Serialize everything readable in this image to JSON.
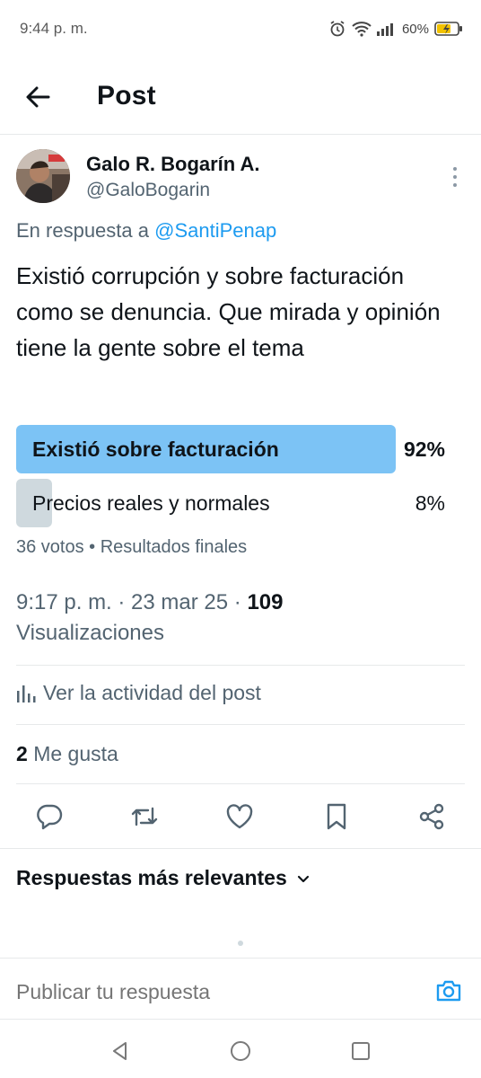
{
  "status_bar": {
    "time": "9:44 p. m.",
    "battery": "60%",
    "icons": [
      "alarm-icon",
      "wifi-icon",
      "signal-icon",
      "battery-charging-icon"
    ]
  },
  "header": {
    "title": "Post",
    "back_icon": "arrow-left-icon"
  },
  "post": {
    "author_name": "Galo R. Bogarín A.",
    "author_handle": "@GaloBogarin",
    "reply_prefix": "En respuesta a",
    "reply_mention": "@SantiPenap",
    "text": "Existió corrupción y sobre facturación como se denuncia. Que mirada y opinión tiene la gente sobre el tema",
    "poll": {
      "options": [
        {
          "label": "Existió sobre facturación",
          "percent_text": "92%",
          "percent": 92,
          "winner": true
        },
        {
          "label": "Precios reales y normales",
          "percent_text": "8%",
          "percent": 8,
          "winner": false
        }
      ],
      "meta": "36 votos • Resultados finales"
    },
    "timestamp": "9:17 p. m. · 23 mar 25 ·",
    "views_count": "109",
    "views_label": "Visualizaciones",
    "activity_label": "Ver la actividad del post",
    "likes_count": "2",
    "likes_label": "Me gusta"
  },
  "actions": [
    "reply-icon",
    "retweet-icon",
    "like-icon",
    "bookmark-icon",
    "share-icon"
  ],
  "replies": {
    "sort_label": "Respuestas más relevantes"
  },
  "reply_box": {
    "placeholder": "Publicar tu respuesta"
  },
  "colors": {
    "accent": "#1d9bf0",
    "poll_winner": "#7cc3f5",
    "poll_other": "#cfd9de",
    "secondary_text": "#536471"
  }
}
